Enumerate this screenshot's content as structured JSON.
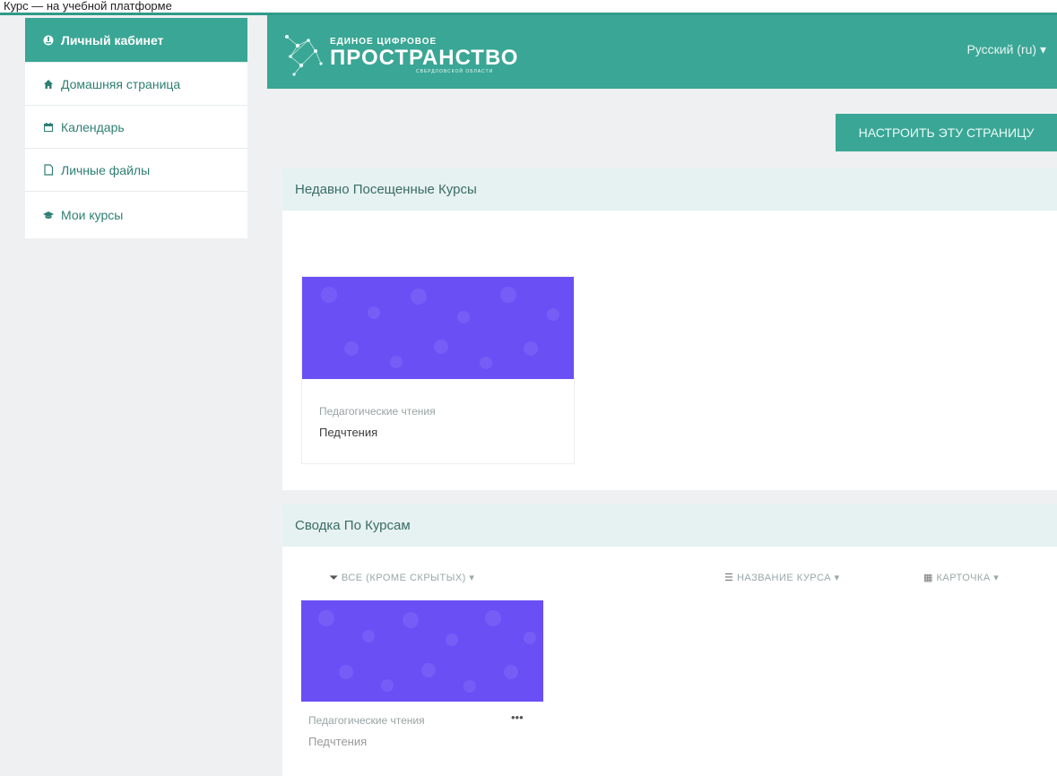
{
  "top_strip": {
    "text": "Курс — на учебной платформе"
  },
  "sidebar": {
    "items": [
      {
        "label": "Личный кабинет",
        "icon": "dashboard-icon",
        "active": true
      },
      {
        "label": "Домашняя страница",
        "icon": "home-icon"
      },
      {
        "label": "Календарь",
        "icon": "calendar-icon"
      },
      {
        "label": "Личные файлы",
        "icon": "file-icon"
      },
      {
        "label": "Мои курсы",
        "icon": "graduation-cap-icon"
      }
    ]
  },
  "header": {
    "logo_small": "ЕДИНОЕ ЦИФРОВОЕ",
    "logo_big": "ПРОСТРАНСТВО",
    "logo_tiny": "СВЕРДЛОВСКОЙ ОБЛАСТИ",
    "language": "Русский (ru) ▾",
    "accent_color": "#3aa695"
  },
  "customize_button": {
    "label": "НАСТРОИТЬ ЭТУ СТРАНИЦУ"
  },
  "recent": {
    "title": "Недавно Посещенные Курсы",
    "course": {
      "category": "Педагогические чтения",
      "name": "Педчтения",
      "image_color": "#6a4ff5"
    }
  },
  "overview": {
    "title": "Сводка По Курсам",
    "filter": "ВСЕ (КРОМЕ СКРЫТЫХ) ▾",
    "sort": "НАЗВАНИЕ КУРСА ▾",
    "view": "КАРТОЧКА ▾",
    "course": {
      "category": "Педагогические чтения",
      "name": "Педчтения",
      "menu": "•••",
      "image_color": "#6a4ff5"
    }
  }
}
